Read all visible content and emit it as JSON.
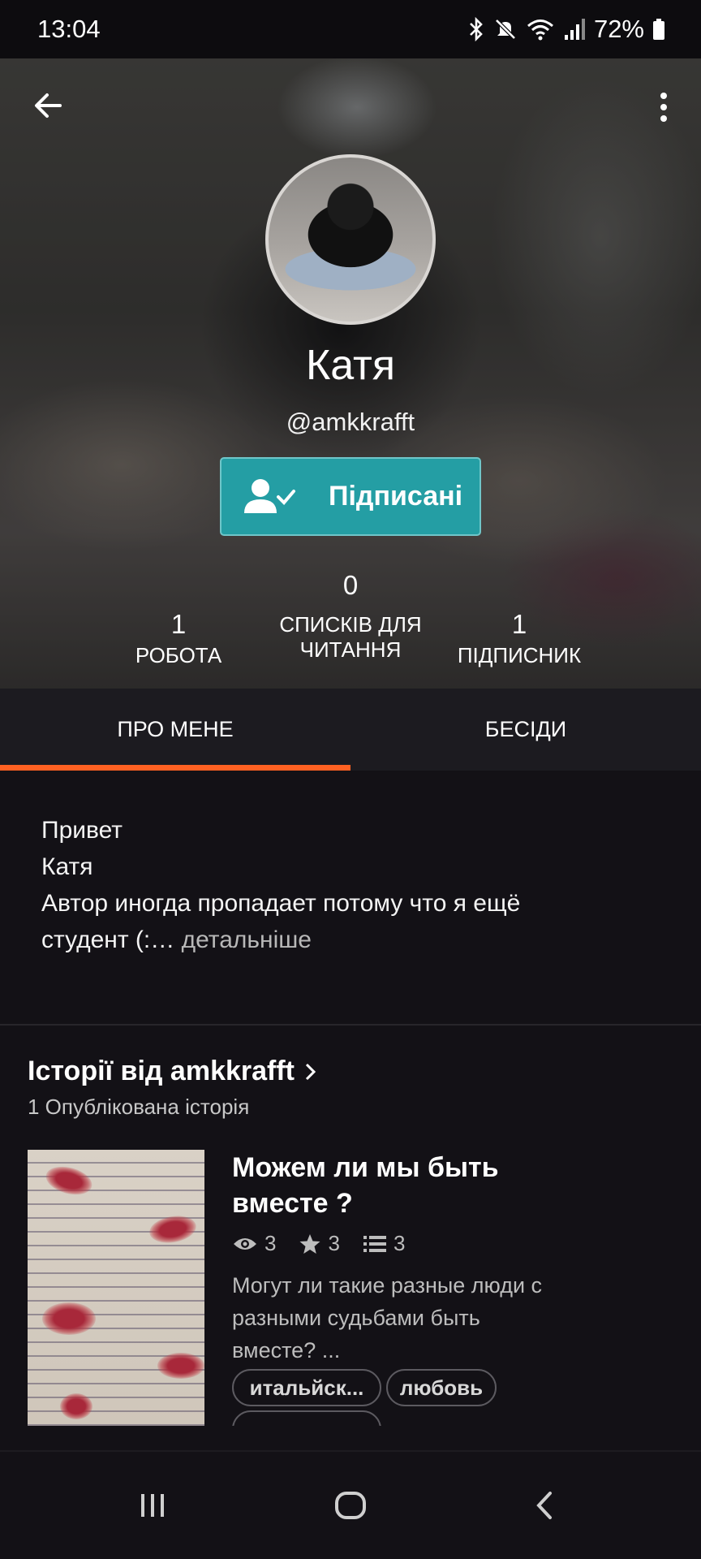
{
  "status_bar": {
    "time": "13:04",
    "battery": "72%"
  },
  "header": {
    "name": "Катя",
    "handle": "@amkkrafft",
    "follow_label": "Підписані"
  },
  "stats": {
    "works": {
      "value": "1",
      "label": "РОБОТА"
    },
    "lists": {
      "value": "0",
      "label_line1": "СПИСКІВ ДЛЯ",
      "label_line2": "ЧИТАННЯ"
    },
    "followers": {
      "value": "1",
      "label": "ПІДПИСНИК"
    }
  },
  "tabs": [
    {
      "label": "ПРО МЕНЕ",
      "active": true
    },
    {
      "label": "БЕСІДИ",
      "active": false
    }
  ],
  "about": {
    "line1": "Привет",
    "line2": "Катя",
    "line3": "Автор иногда пропадает потому что я ещё",
    "line4": "студент (:…",
    "more": "детальніше"
  },
  "stories": {
    "title": "Історії від amkkrafft",
    "subtitle": "1 Опублікована історія",
    "items": [
      {
        "title": "Можем ли мы быть вместе ?",
        "reads": "3",
        "votes": "3",
        "parts": "3",
        "description": "Могут ли такие разные люди с разными судьбами быть вместе? ...",
        "tags": [
          "итальйск...",
          "любовь",
          ""
        ]
      }
    ]
  },
  "icons": {
    "back": "arrow-left-icon",
    "more": "more-vertical-icon",
    "follow": "user-check-icon",
    "reads": "eye-icon",
    "votes": "star-icon",
    "parts": "list-icon",
    "chevron": "chevron-right-icon"
  },
  "colors": {
    "accent": "#ff6122",
    "follow_button": "#249ea4",
    "background": "#131116"
  }
}
